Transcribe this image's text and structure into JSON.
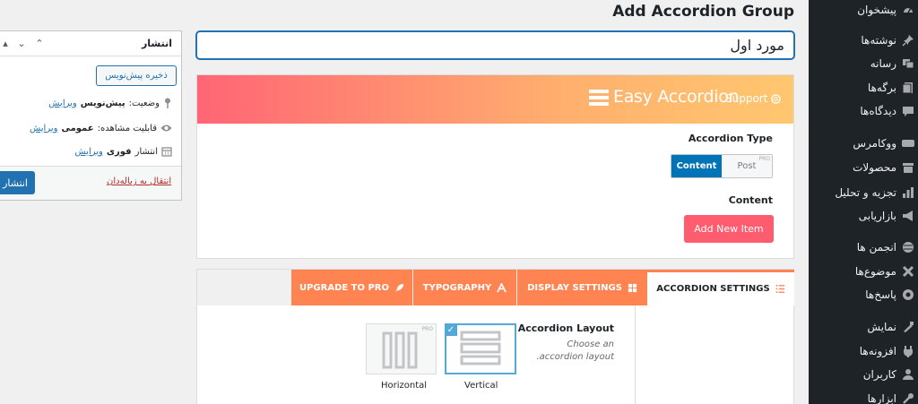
{
  "page": {
    "title": "Add Accordion Group"
  },
  "post_title": {
    "value": "مورد اول"
  },
  "sidebar": {
    "items": [
      {
        "label": "پیشخوان",
        "icon": "dashboard-icon"
      },
      {
        "label": "نوشته‌ها",
        "icon": "pin-icon"
      },
      {
        "label": "رسانه",
        "icon": "media-icon"
      },
      {
        "label": "برگه‌ها",
        "icon": "page-icon"
      },
      {
        "label": "دیدگاه‌ها",
        "icon": "comment-icon"
      },
      {
        "label": "ووکامرس",
        "icon": "woocommerce-icon"
      },
      {
        "label": "محصولات",
        "icon": "archive-icon"
      },
      {
        "label": "تجزیه و تحلیل",
        "icon": "chart-icon"
      },
      {
        "label": "بازاریابی",
        "icon": "megaphone-icon"
      },
      {
        "label": "انجمن ها",
        "icon": "forum-icon"
      },
      {
        "label": "موضوع‌ها",
        "icon": "topic-icon"
      },
      {
        "label": "پاسخ‌ها",
        "icon": "reply-icon"
      },
      {
        "label": "نمایش",
        "icon": "appearance-icon"
      },
      {
        "label": "افزونه‌ها",
        "icon": "plugin-icon"
      },
      {
        "label": "کاربران",
        "icon": "users-icon"
      },
      {
        "label": "ابزارها",
        "icon": "tools-icon"
      }
    ]
  },
  "easy_accordion": {
    "brand": "Easy Accordion",
    "support_label": "Support",
    "type_label": "Accordion Type",
    "type_options": [
      "Content",
      "Post"
    ],
    "type_selected": "Content",
    "pro_badge": "PRO",
    "content_label": "Content",
    "add_item_label": "Add New Item"
  },
  "settings": {
    "tabs": [
      {
        "label": "ACCORDION SETTINGS",
        "icon": "list-icon",
        "active": true
      },
      {
        "label": "DISPLAY SETTINGS",
        "icon": "grid-icon",
        "active": false
      },
      {
        "label": "TYPOGRAPHY",
        "icon": "font-icon",
        "active": false
      },
      {
        "label": "UPGRADE TO PRO",
        "icon": "rocket-icon",
        "active": false
      }
    ],
    "layout_label": "Accordion Layout",
    "layout_help": "Choose an accordion layout.",
    "layouts": [
      {
        "name": "Vertical",
        "selected": true,
        "pro": false
      },
      {
        "name": "Horizontal",
        "selected": false,
        "pro": true
      }
    ],
    "pro_badge": "PRO"
  },
  "publish": {
    "title": "انتشار",
    "save_draft_label": "ذخیره پیش‌نویس",
    "status_label": "وضعیت:",
    "status_value": "پیش‌نویس",
    "visibility_label": "قابلیت مشاهده:",
    "visibility_value": "عمومی",
    "publish_label": "انتشار",
    "publish_value": "فوری",
    "edit_label": "ویرایش",
    "trash_label": "انتقال به زباله‌دان",
    "publish_button_label": "انتشار"
  },
  "colors": {
    "accent_orange": "#ff8451",
    "add_item_red": "#ff5c6f",
    "wp_blue": "#2271b1",
    "toggle_blue": "#0074b7",
    "sidebar_bg": "#1d2327"
  }
}
